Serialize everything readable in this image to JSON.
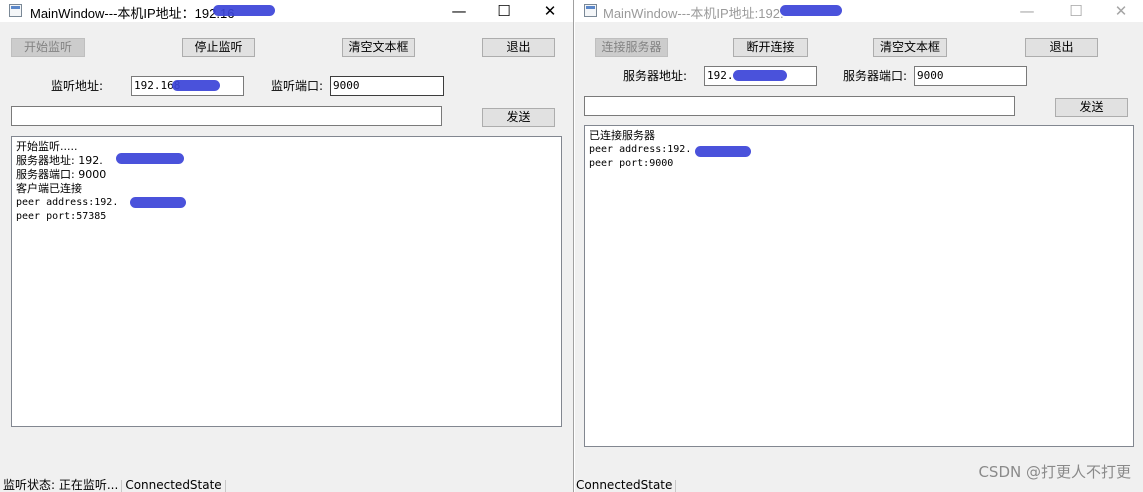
{
  "server": {
    "title": "MainWindow---本机IP地址：192.16",
    "controls": {
      "minimize": "—",
      "maximize": "☐",
      "close": "✕"
    },
    "buttons": {
      "start": "开始监听",
      "stop": "停止监听",
      "clear": "清空文本框",
      "exit": "退出",
      "send": "发送"
    },
    "fields": {
      "address_label": "监听地址:",
      "address_value": "192.168",
      "port_label": "监听端口:",
      "port_value": "9000",
      "message_value": ""
    },
    "log": [
      "开始监听.....",
      "服务器地址: 192.",
      "服务器端口: 9000",
      "客户端已连接",
      "peer address:192.",
      "peer port:57385"
    ],
    "status": {
      "state_label": "监听状态: 正在监听...",
      "connection": "ConnectedState"
    }
  },
  "client": {
    "title": "MainWindow---本机IP地址:192.",
    "controls": {
      "minimize": "—",
      "maximize": "☐",
      "close": "✕"
    },
    "buttons": {
      "connect": "连接服务器",
      "disconnect": "断开连接",
      "clear": "清空文本框",
      "exit": "退出",
      "send": "发送"
    },
    "fields": {
      "address_label": "服务器地址:",
      "address_value": "192.",
      "port_label": "服务器端口:",
      "port_value": "9000",
      "message_value": ""
    },
    "log": [
      "已连接服务器",
      "peer address:192.",
      "peer port:9000"
    ],
    "status": {
      "connection": "ConnectedState"
    }
  },
  "watermark": "CSDN @打更人不打更"
}
